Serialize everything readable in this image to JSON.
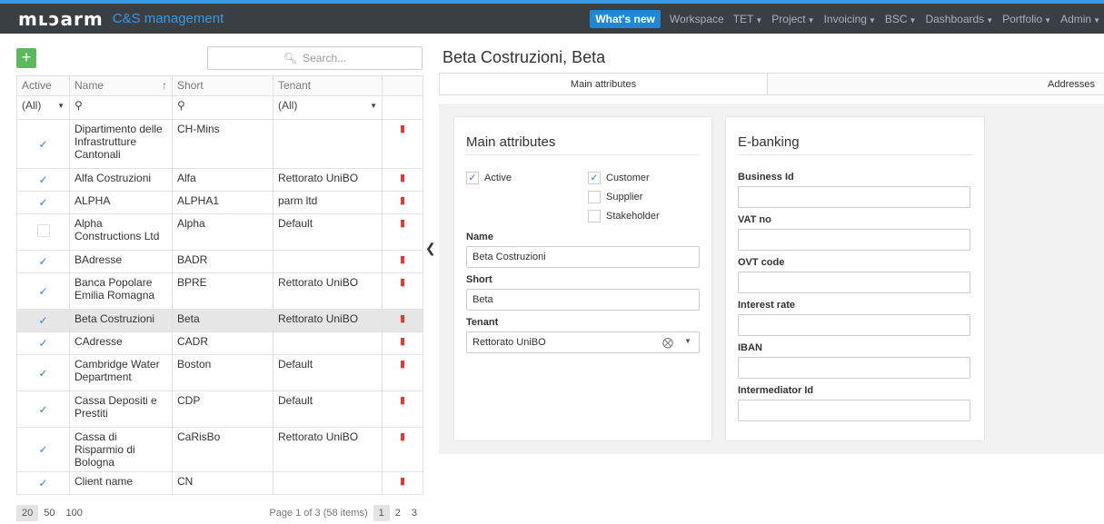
{
  "header": {
    "logo": "mʟɔarm",
    "app_title": "C&S management",
    "whats_new": "What's new",
    "nav": [
      "Workspace",
      "TET",
      "Project",
      "Invoicing",
      "BSC",
      "Dashboards",
      "Portfolio",
      "Admin"
    ],
    "nav_dropdown": [
      false,
      true,
      true,
      true,
      true,
      true,
      true,
      true
    ]
  },
  "left": {
    "add_label": "+",
    "search_placeholder": "Search...",
    "columns": [
      "Active",
      "Name",
      "Short",
      "Tenant"
    ],
    "filters": {
      "active": "(All)",
      "tenant": "(All)"
    },
    "rows": [
      {
        "active": true,
        "name": "Dipartimento delle Infrastrutture Cantonali",
        "short": "CH-Mins",
        "tenant": ""
      },
      {
        "active": true,
        "name": "Alfa Costruzioni",
        "short": "Alfa",
        "tenant": "Rettorato UniBO"
      },
      {
        "active": true,
        "name": "ALPHA",
        "short": "ALPHA1",
        "tenant": "parm ltd"
      },
      {
        "active": false,
        "name": "Alpha Constructions Ltd",
        "short": "Alpha",
        "tenant": "Default"
      },
      {
        "active": true,
        "name": "BAdresse",
        "short": "BADR",
        "tenant": ""
      },
      {
        "active": true,
        "name": "Banca Popolare Emilia Romagna",
        "short": "BPRE",
        "tenant": "Rettorato UniBO"
      },
      {
        "active": true,
        "name": "Beta Costruzioni",
        "short": "Beta",
        "tenant": "Rettorato UniBO",
        "selected": true
      },
      {
        "active": true,
        "name": "CAdresse",
        "short": "CADR",
        "tenant": ""
      },
      {
        "active": true,
        "name": "Cambridge Water Department",
        "short": "Boston",
        "tenant": "Default"
      },
      {
        "active": true,
        "name": "Cassa Depositi e Prestiti",
        "short": "CDP",
        "tenant": "Default"
      },
      {
        "active": true,
        "name": "Cassa di Risparmio di Bologna",
        "short": "CaRisBo",
        "tenant": "Rettorato UniBO"
      },
      {
        "active": true,
        "name": "Client name",
        "short": "CN",
        "tenant": ""
      }
    ],
    "pager": {
      "sizes": [
        "20",
        "50",
        "100"
      ],
      "info": "Page 1 of 3 (58 items)",
      "pages": [
        "1",
        "2",
        "3"
      ]
    }
  },
  "detail": {
    "title": "Beta Costruzioni, Beta",
    "tabs": [
      "Main attributes",
      "Addresses"
    ],
    "main": {
      "title": "Main attributes",
      "active_label": "Active",
      "active": true,
      "customer_label": "Customer",
      "customer": true,
      "supplier_label": "Supplier",
      "supplier": false,
      "stakeholder_label": "Stakeholder",
      "stakeholder": false,
      "name_label": "Name",
      "name_value": "Beta Costruzioni",
      "short_label": "Short",
      "short_value": "Beta",
      "tenant_label": "Tenant",
      "tenant_value": "Rettorato UniBO"
    },
    "ebanking": {
      "title": "E-banking",
      "fields": [
        {
          "label": "Business Id",
          "value": ""
        },
        {
          "label": "VAT no",
          "value": ""
        },
        {
          "label": "OVT code",
          "value": ""
        },
        {
          "label": "Interest rate",
          "value": ""
        },
        {
          "label": "IBAN",
          "value": ""
        },
        {
          "label": "Intermediator Id",
          "value": ""
        }
      ]
    }
  },
  "colors": {
    "accent": "#3b99e0",
    "header_bg": "#3a3f44",
    "add": "#5cb85c",
    "delete": "#e53935"
  }
}
